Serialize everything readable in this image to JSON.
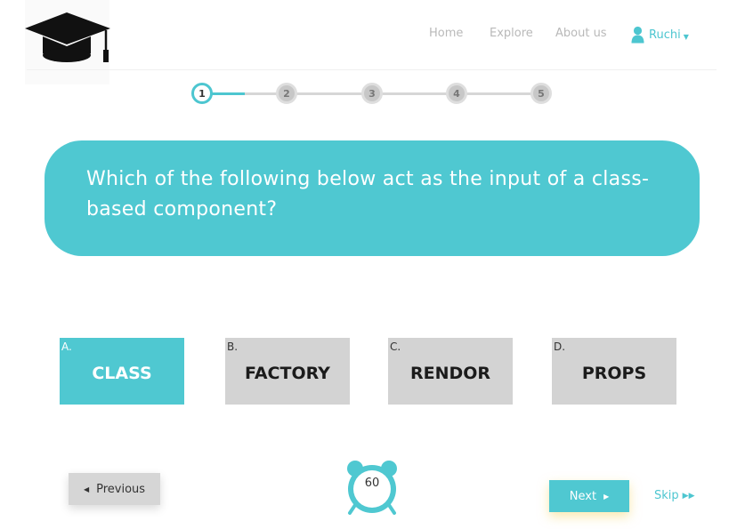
{
  "header": {
    "logo_icon": "graduation-cap-icon",
    "nav": [
      {
        "label": "Home"
      },
      {
        "label": "Explore"
      },
      {
        "label": "About us"
      }
    ],
    "user": {
      "name": "Ruchi",
      "icon": "user-icon",
      "caret": "▼"
    }
  },
  "stepper": {
    "steps": [
      "1",
      "2",
      "3",
      "4",
      "5"
    ],
    "current": 1,
    "accent": "#4dc6d0"
  },
  "question": {
    "text": "Which of the following below act as the input of a class-based component?"
  },
  "options": [
    {
      "letter": "A.",
      "text": "CLASS",
      "selected": true
    },
    {
      "letter": "B.",
      "text": "FACTORY",
      "selected": false
    },
    {
      "letter": "C.",
      "text": "RENDOR",
      "selected": false
    },
    {
      "letter": "D.",
      "text": "PROPS",
      "selected": false
    }
  ],
  "footer": {
    "previous_label": "Previous",
    "previous_arrow": "◀",
    "timer_value": "60",
    "timer_icon": "alarm-clock-icon",
    "next_label": "Next",
    "next_arrow": "▶",
    "skip_label": "Skip",
    "skip_arrow": "▶▶"
  },
  "colors": {
    "accent": "#4fc8d1",
    "option_default": "#d3d3d3",
    "nav_text": "#b9b9b9"
  }
}
